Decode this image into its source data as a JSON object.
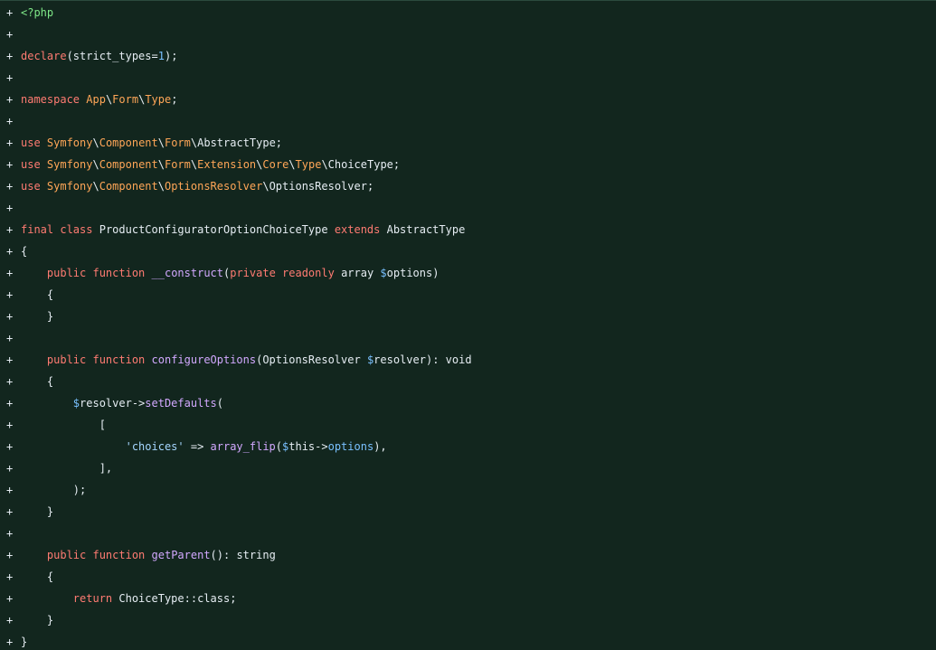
{
  "diff": {
    "marker": "+",
    "lines": [
      [
        {
          "t": "<?php",
          "c": "tag"
        }
      ],
      [],
      [
        {
          "t": "declare",
          "c": "kw"
        },
        {
          "t": "(strict_types=",
          "c": "pl"
        },
        {
          "t": "1",
          "c": "num"
        },
        {
          "t": ");",
          "c": "pl"
        }
      ],
      [],
      [
        {
          "t": "namespace ",
          "c": "kw"
        },
        {
          "t": "App",
          "c": "ns"
        },
        {
          "t": "\\",
          "c": "pl"
        },
        {
          "t": "Form",
          "c": "ns"
        },
        {
          "t": "\\",
          "c": "pl"
        },
        {
          "t": "Type",
          "c": "ns"
        },
        {
          "t": ";",
          "c": "pl"
        }
      ],
      [],
      [
        {
          "t": "use ",
          "c": "kw"
        },
        {
          "t": "Symfony",
          "c": "ns"
        },
        {
          "t": "\\",
          "c": "pl"
        },
        {
          "t": "Component",
          "c": "ns"
        },
        {
          "t": "\\",
          "c": "pl"
        },
        {
          "t": "Form",
          "c": "ns"
        },
        {
          "t": "\\AbstractType;",
          "c": "pl"
        }
      ],
      [
        {
          "t": "use ",
          "c": "kw"
        },
        {
          "t": "Symfony",
          "c": "ns"
        },
        {
          "t": "\\",
          "c": "pl"
        },
        {
          "t": "Component",
          "c": "ns"
        },
        {
          "t": "\\",
          "c": "pl"
        },
        {
          "t": "Form",
          "c": "ns"
        },
        {
          "t": "\\",
          "c": "pl"
        },
        {
          "t": "Extension",
          "c": "ns"
        },
        {
          "t": "\\",
          "c": "pl"
        },
        {
          "t": "Core",
          "c": "ns"
        },
        {
          "t": "\\",
          "c": "pl"
        },
        {
          "t": "Type",
          "c": "ns"
        },
        {
          "t": "\\ChoiceType;",
          "c": "pl"
        }
      ],
      [
        {
          "t": "use ",
          "c": "kw"
        },
        {
          "t": "Symfony",
          "c": "ns"
        },
        {
          "t": "\\",
          "c": "pl"
        },
        {
          "t": "Component",
          "c": "ns"
        },
        {
          "t": "\\",
          "c": "pl"
        },
        {
          "t": "OptionsResolver",
          "c": "ns"
        },
        {
          "t": "\\OptionsResolver;",
          "c": "pl"
        }
      ],
      [],
      [
        {
          "t": "final ",
          "c": "kw"
        },
        {
          "t": "class ",
          "c": "kw"
        },
        {
          "t": "ProductConfiguratorOptionChoiceType ",
          "c": "pl"
        },
        {
          "t": "extends ",
          "c": "kw"
        },
        {
          "t": "AbstractType",
          "c": "pl"
        }
      ],
      [
        {
          "t": "{",
          "c": "pl"
        }
      ],
      [
        {
          "t": "    ",
          "c": "pl"
        },
        {
          "t": "public ",
          "c": "kw"
        },
        {
          "t": "function ",
          "c": "kw"
        },
        {
          "t": "__construct",
          "c": "fn"
        },
        {
          "t": "(",
          "c": "pl"
        },
        {
          "t": "private ",
          "c": "kw"
        },
        {
          "t": "readonly ",
          "c": "kw"
        },
        {
          "t": "array ",
          "c": "pl"
        },
        {
          "t": "$",
          "c": "var"
        },
        {
          "t": "options)",
          "c": "pl"
        }
      ],
      [
        {
          "t": "    {",
          "c": "pl"
        }
      ],
      [
        {
          "t": "    }",
          "c": "pl"
        }
      ],
      [],
      [
        {
          "t": "    ",
          "c": "pl"
        },
        {
          "t": "public ",
          "c": "kw"
        },
        {
          "t": "function ",
          "c": "kw"
        },
        {
          "t": "configureOptions",
          "c": "fn"
        },
        {
          "t": "(OptionsResolver ",
          "c": "pl"
        },
        {
          "t": "$",
          "c": "var"
        },
        {
          "t": "resolver): void",
          "c": "pl"
        }
      ],
      [
        {
          "t": "    {",
          "c": "pl"
        }
      ],
      [
        {
          "t": "        ",
          "c": "pl"
        },
        {
          "t": "$",
          "c": "var"
        },
        {
          "t": "resolver->",
          "c": "pl"
        },
        {
          "t": "setDefaults",
          "c": "fn"
        },
        {
          "t": "(",
          "c": "pl"
        }
      ],
      [
        {
          "t": "            [",
          "c": "pl"
        }
      ],
      [
        {
          "t": "                ",
          "c": "pl"
        },
        {
          "t": "'choices'",
          "c": "str"
        },
        {
          "t": " => ",
          "c": "pl"
        },
        {
          "t": "array_flip",
          "c": "fn"
        },
        {
          "t": "(",
          "c": "pl"
        },
        {
          "t": "$",
          "c": "var"
        },
        {
          "t": "this->",
          "c": "pl"
        },
        {
          "t": "options",
          "c": "var"
        },
        {
          "t": "),",
          "c": "pl"
        }
      ],
      [
        {
          "t": "            ],",
          "c": "pl"
        }
      ],
      [
        {
          "t": "        );",
          "c": "pl"
        }
      ],
      [
        {
          "t": "    }",
          "c": "pl"
        }
      ],
      [],
      [
        {
          "t": "    ",
          "c": "pl"
        },
        {
          "t": "public ",
          "c": "kw"
        },
        {
          "t": "function ",
          "c": "kw"
        },
        {
          "t": "getParent",
          "c": "fn"
        },
        {
          "t": "(): string",
          "c": "pl"
        }
      ],
      [
        {
          "t": "    {",
          "c": "pl"
        }
      ],
      [
        {
          "t": "        ",
          "c": "pl"
        },
        {
          "t": "return ",
          "c": "kw"
        },
        {
          "t": "ChoiceType::class;",
          "c": "pl"
        }
      ],
      [
        {
          "t": "    }",
          "c": "pl"
        }
      ],
      [
        {
          "t": "}",
          "c": "pl"
        }
      ]
    ]
  }
}
